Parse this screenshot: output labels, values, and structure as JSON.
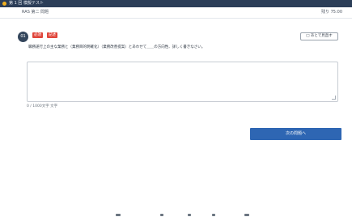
{
  "window": {
    "title": "第 1 回 模擬テスト"
  },
  "header": {
    "breadcrumb": "RAS 第二 問題",
    "timer": "残り 75:00"
  },
  "question": {
    "number": "01",
    "tags": [
      "必須",
      "記述"
    ],
    "text": "職務遂行上の主な業務と（業務目的明確化）（業務改善提案）とあわせて＿＿の方向性、詳しく書きなさい。",
    "mark_label": "□ あとで見直す"
  },
  "answer": {
    "value": "",
    "placeholder": "",
    "char_count": "0 / 1000文字 文字"
  },
  "actions": {
    "next_label": "次の問題へ"
  },
  "footer": {
    "nav_dots": 5
  },
  "colors": {
    "titlebar": "#2c3e58",
    "accent": "#2e66b3",
    "tag": "#e0453a",
    "badge": "#34465c"
  }
}
